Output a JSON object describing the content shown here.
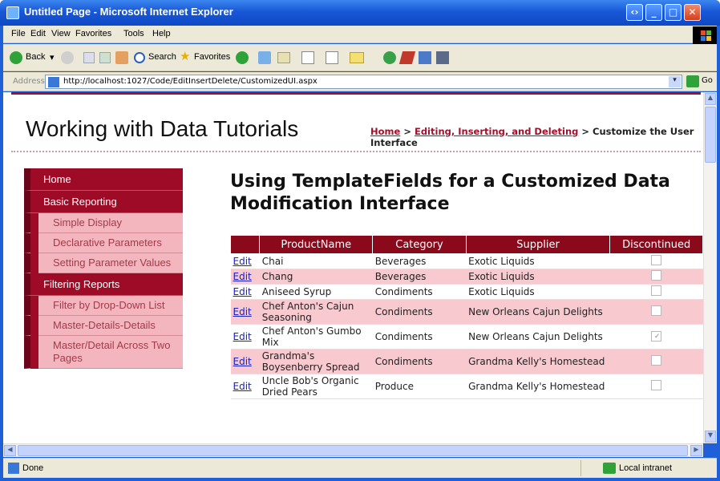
{
  "window": {
    "title": "Untitled Page - Microsoft Internet Explorer"
  },
  "menu": [
    "File",
    "Edit",
    "View",
    "Favorites",
    "Tools",
    "Help"
  ],
  "toolbar": {
    "back_label": "Back",
    "search_label": "Search",
    "favorites_label": "Favorites"
  },
  "address": {
    "label": "Address",
    "url": "http://localhost:1027/Code/EditInsertDelete/CustomizedUI.aspx",
    "go_label": "Go"
  },
  "page": {
    "site_title": "Working with Data Tutorials",
    "breadcrumb": {
      "home": "Home",
      "sep1": " > ",
      "section": "Editing, Inserting, and Deleting",
      "sep2": " > ",
      "current": "Customize the User Interface"
    },
    "heading": "Using TemplateFields for a Customized Data Modification Interface"
  },
  "sidebar": {
    "groups": [
      {
        "label": "Home",
        "items": []
      },
      {
        "label": "Basic Reporting",
        "items": [
          "Simple Display",
          "Declarative Parameters",
          "Setting Parameter Values"
        ]
      },
      {
        "label": "Filtering Reports",
        "items": [
          "Filter by Drop-Down List",
          "Master-Details-Details",
          "Master/Detail Across Two Pages"
        ]
      }
    ]
  },
  "grid": {
    "columns": [
      "",
      "ProductName",
      "Category",
      "Supplier",
      "Discontinued"
    ],
    "edit_label": "Edit",
    "rows": [
      {
        "product": "Chai",
        "category": "Beverages",
        "supplier": "Exotic Liquids",
        "discontinued": false
      },
      {
        "product": "Chang",
        "category": "Beverages",
        "supplier": "Exotic Liquids",
        "discontinued": false
      },
      {
        "product": "Aniseed Syrup",
        "category": "Condiments",
        "supplier": "Exotic Liquids",
        "discontinued": false
      },
      {
        "product": "Chef Anton's Cajun Seasoning",
        "category": "Condiments",
        "supplier": "New Orleans Cajun Delights",
        "discontinued": false
      },
      {
        "product": "Chef Anton's Gumbo Mix",
        "category": "Condiments",
        "supplier": "New Orleans Cajun Delights",
        "discontinued": true
      },
      {
        "product": "Grandma's Boysenberry Spread",
        "category": "Condiments",
        "supplier": "Grandma Kelly's Homestead",
        "discontinued": false
      },
      {
        "product": "Uncle Bob's Organic Dried Pears",
        "category": "Produce",
        "supplier": "Grandma Kelly's Homestead",
        "discontinued": false
      }
    ]
  },
  "status": {
    "left": "Done",
    "zone": "Local intranet"
  },
  "colors": {
    "accent": "#9e0b27",
    "nav_sub": "#f4b6be",
    "row_alt": "#f8c9cf",
    "link": "#1a22c0"
  }
}
